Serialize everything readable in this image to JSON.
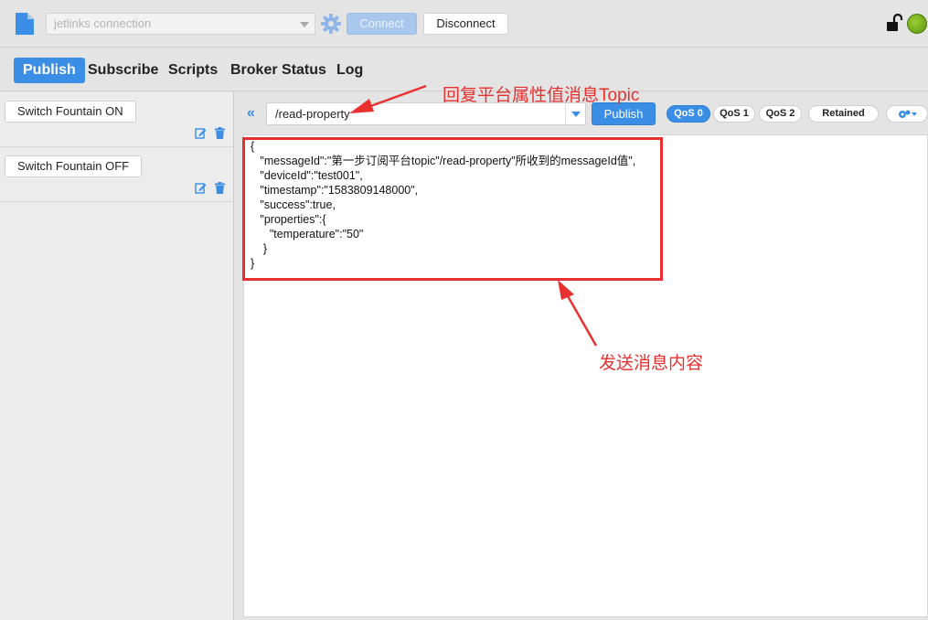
{
  "header": {
    "connection_select": "jetlinks connection",
    "connect_label": "Connect",
    "disconnect_label": "Disconnect",
    "icons": [
      "file-icon",
      "gear-icon",
      "unlock-icon",
      "status-dot-icon"
    ],
    "status_color": "#7cb518"
  },
  "tabs": [
    {
      "label": "Publish",
      "active": true
    },
    {
      "label": "Subscribe",
      "active": false
    },
    {
      "label": "Scripts",
      "active": false
    },
    {
      "label": "Broker Status",
      "active": false
    },
    {
      "label": "Log",
      "active": false
    }
  ],
  "scripts": [
    {
      "label": "Switch Fountain ON"
    },
    {
      "label": "Switch Fountain OFF"
    }
  ],
  "publish": {
    "topic": "/read-property",
    "publish_label": "Publish",
    "qos": [
      {
        "label": "QoS 0",
        "active": true
      },
      {
        "label": "QoS 1",
        "active": false
      },
      {
        "label": "QoS 2",
        "active": false
      }
    ],
    "retained_label": "Retained",
    "payload": "{\n   \"messageId\":\"第一步订阅平台topic\"/read-property\"所收到的messageId值\",\n   \"deviceId\":\"test001\",\n   \"timestamp\":\"1583809148000\",\n   \"success\":true,\n   \"properties\":{\n      \"temperature\":\"50\"\n    }\n}"
  },
  "annotations": {
    "topic_note": "回复平台属性值消息Topic",
    "payload_note": "发送消息内容",
    "color": "#e8302f"
  }
}
